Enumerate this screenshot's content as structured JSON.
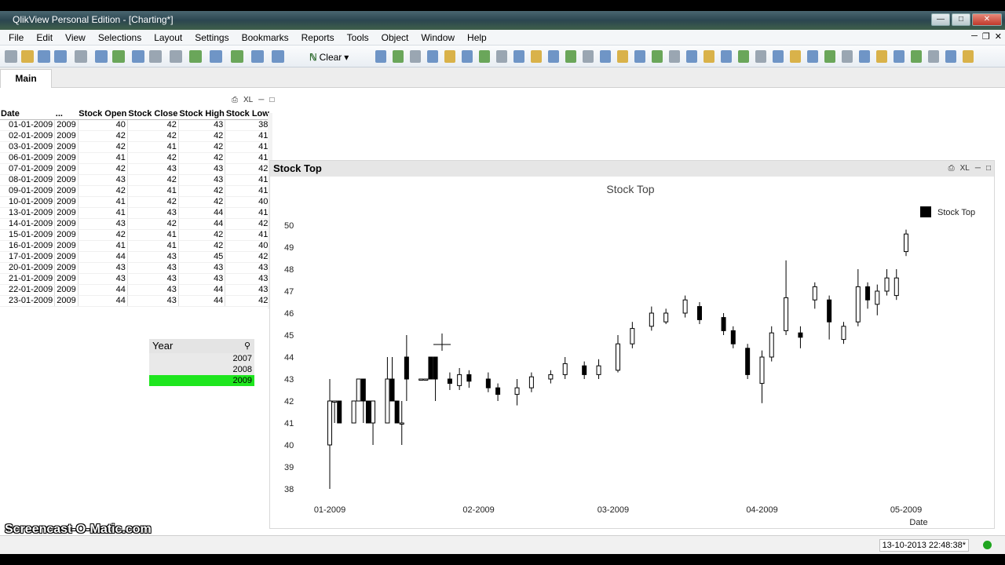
{
  "window": {
    "title": "QlikView Personal Edition - [Charting*]"
  },
  "menu": [
    "File",
    "Edit",
    "View",
    "Selections",
    "Layout",
    "Settings",
    "Bookmarks",
    "Reports",
    "Tools",
    "Object",
    "Window",
    "Help"
  ],
  "toolbar": {
    "clear_label": "Clear"
  },
  "tabs": [
    {
      "label": "Main",
      "active": true
    }
  ],
  "table": {
    "headers": [
      "Date",
      "...",
      "Stock Open",
      "Stock Close",
      "Stock High",
      "Stock Low"
    ],
    "rows": [
      [
        "01-01-2009",
        "2009",
        "40",
        "42",
        "43",
        "38"
      ],
      [
        "02-01-2009",
        "2009",
        "42",
        "42",
        "42",
        "41"
      ],
      [
        "03-01-2009",
        "2009",
        "42",
        "41",
        "42",
        "41"
      ],
      [
        "06-01-2009",
        "2009",
        "41",
        "42",
        "42",
        "41"
      ],
      [
        "07-01-2009",
        "2009",
        "42",
        "43",
        "43",
        "42"
      ],
      [
        "08-01-2009",
        "2009",
        "43",
        "42",
        "43",
        "41"
      ],
      [
        "09-01-2009",
        "2009",
        "42",
        "41",
        "42",
        "41"
      ],
      [
        "10-01-2009",
        "2009",
        "41",
        "42",
        "42",
        "40"
      ],
      [
        "13-01-2009",
        "2009",
        "41",
        "43",
        "44",
        "41"
      ],
      [
        "14-01-2009",
        "2009",
        "43",
        "42",
        "44",
        "42"
      ],
      [
        "15-01-2009",
        "2009",
        "42",
        "41",
        "42",
        "41"
      ],
      [
        "16-01-2009",
        "2009",
        "41",
        "41",
        "42",
        "40"
      ],
      [
        "17-01-2009",
        "2009",
        "44",
        "43",
        "45",
        "42"
      ],
      [
        "20-01-2009",
        "2009",
        "43",
        "43",
        "43",
        "43"
      ],
      [
        "21-01-2009",
        "2009",
        "43",
        "43",
        "43",
        "43"
      ],
      [
        "22-01-2009",
        "2009",
        "44",
        "43",
        "44",
        "43"
      ],
      [
        "23-01-2009",
        "2009",
        "44",
        "43",
        "44",
        "42"
      ]
    ]
  },
  "listbox": {
    "title": "Year",
    "items": [
      {
        "label": "2007",
        "selected": false
      },
      {
        "label": "2008",
        "selected": false
      },
      {
        "label": "2009",
        "selected": true
      }
    ],
    "selected_color": "#1ee61e"
  },
  "chart_caption": "Stock Top",
  "chart_data": {
    "type": "candlestick",
    "title": "Stock Top",
    "xlabel": "Date",
    "ylabel": "",
    "ylim": [
      38,
      50
    ],
    "yticks": [
      38,
      39,
      40,
      41,
      42,
      43,
      44,
      45,
      46,
      47,
      48,
      49,
      50
    ],
    "xticks": [
      "01-2009",
      "02-2009",
      "03-2009",
      "04-2009",
      "05-2009"
    ],
    "xtick_dates": [
      "2009-01-01",
      "2009-02-01",
      "2009-03-01",
      "2009-04-01",
      "2009-05-01"
    ],
    "legend": {
      "entries": [
        "Stock Top"
      ],
      "placement": "top-right"
    },
    "series": [
      {
        "name": "Stock Top",
        "points": [
          {
            "date": "2009-01-01",
            "open": 40,
            "close": 42,
            "high": 43,
            "low": 38
          },
          {
            "date": "2009-01-02",
            "open": 42,
            "close": 42,
            "high": 42,
            "low": 41
          },
          {
            "date": "2009-01-03",
            "open": 42,
            "close": 41,
            "high": 42,
            "low": 41
          },
          {
            "date": "2009-01-06",
            "open": 41,
            "close": 42,
            "high": 42,
            "low": 41
          },
          {
            "date": "2009-01-07",
            "open": 42,
            "close": 43,
            "high": 43,
            "low": 42
          },
          {
            "date": "2009-01-08",
            "open": 43,
            "close": 42,
            "high": 43,
            "low": 41
          },
          {
            "date": "2009-01-09",
            "open": 42,
            "close": 41,
            "high": 42,
            "low": 41
          },
          {
            "date": "2009-01-10",
            "open": 41,
            "close": 42,
            "high": 42,
            "low": 40
          },
          {
            "date": "2009-01-13",
            "open": 41,
            "close": 43,
            "high": 44,
            "low": 41
          },
          {
            "date": "2009-01-14",
            "open": 43,
            "close": 42,
            "high": 44,
            "low": 42
          },
          {
            "date": "2009-01-15",
            "open": 42,
            "close": 41,
            "high": 42,
            "low": 41
          },
          {
            "date": "2009-01-16",
            "open": 41,
            "close": 41,
            "high": 42,
            "low": 40
          },
          {
            "date": "2009-01-17",
            "open": 44,
            "close": 43,
            "high": 45,
            "low": 42
          },
          {
            "date": "2009-01-20",
            "open": 43,
            "close": 43,
            "high": 43,
            "low": 43
          },
          {
            "date": "2009-01-21",
            "open": 43,
            "close": 43,
            "high": 43,
            "low": 43
          },
          {
            "date": "2009-01-22",
            "open": 44,
            "close": 43,
            "high": 44,
            "low": 43
          },
          {
            "date": "2009-01-23",
            "open": 44,
            "close": 43,
            "high": 44,
            "low": 42
          },
          {
            "date": "2009-01-26",
            "open": 43,
            "close": 42.8,
            "high": 43.3,
            "low": 42.5
          },
          {
            "date": "2009-01-28",
            "open": 42.7,
            "close": 43.2,
            "high": 43.5,
            "low": 42.5
          },
          {
            "date": "2009-01-30",
            "open": 43.2,
            "close": 42.9,
            "high": 43.4,
            "low": 42.6
          },
          {
            "date": "2009-02-03",
            "open": 43,
            "close": 42.6,
            "high": 43.3,
            "low": 42.4
          },
          {
            "date": "2009-02-05",
            "open": 42.6,
            "close": 42.3,
            "high": 42.8,
            "low": 42
          },
          {
            "date": "2009-02-09",
            "open": 42.3,
            "close": 42.6,
            "high": 43,
            "low": 41.8
          },
          {
            "date": "2009-02-12",
            "open": 42.6,
            "close": 43.1,
            "high": 43.3,
            "low": 42.4
          },
          {
            "date": "2009-02-16",
            "open": 43,
            "close": 43.2,
            "high": 43.4,
            "low": 42.8
          },
          {
            "date": "2009-02-19",
            "open": 43.2,
            "close": 43.7,
            "high": 44,
            "low": 43
          },
          {
            "date": "2009-02-23",
            "open": 43.6,
            "close": 43.2,
            "high": 43.8,
            "low": 43
          },
          {
            "date": "2009-02-26",
            "open": 43.2,
            "close": 43.6,
            "high": 43.9,
            "low": 43
          },
          {
            "date": "2009-03-02",
            "open": 43.4,
            "close": 44.6,
            "high": 45,
            "low": 43.3
          },
          {
            "date": "2009-03-05",
            "open": 44.6,
            "close": 45.3,
            "high": 45.6,
            "low": 44.4
          },
          {
            "date": "2009-03-09",
            "open": 45.4,
            "close": 46,
            "high": 46.3,
            "low": 45.2
          },
          {
            "date": "2009-03-12",
            "open": 45.6,
            "close": 46,
            "high": 46.2,
            "low": 45.5
          },
          {
            "date": "2009-03-16",
            "open": 46,
            "close": 46.6,
            "high": 46.8,
            "low": 45.8
          },
          {
            "date": "2009-03-19",
            "open": 46.3,
            "close": 45.7,
            "high": 46.5,
            "low": 45.5
          },
          {
            "date": "2009-03-24",
            "open": 45.8,
            "close": 45.2,
            "high": 46,
            "low": 45
          },
          {
            "date": "2009-03-26",
            "open": 45.2,
            "close": 44.6,
            "high": 45.4,
            "low": 44.4
          },
          {
            "date": "2009-03-29",
            "open": 44.4,
            "close": 43.2,
            "high": 44.6,
            "low": 43
          },
          {
            "date": "2009-04-01",
            "open": 42.8,
            "close": 44,
            "high": 44.3,
            "low": 41.9
          },
          {
            "date": "2009-04-03",
            "open": 44,
            "close": 45.1,
            "high": 45.4,
            "low": 43.8
          },
          {
            "date": "2009-04-06",
            "open": 45.2,
            "close": 46.7,
            "high": 48.4,
            "low": 45
          },
          {
            "date": "2009-04-09",
            "open": 45.1,
            "close": 44.9,
            "high": 45.4,
            "low": 44.4
          },
          {
            "date": "2009-04-12",
            "open": 46.6,
            "close": 47.2,
            "high": 47.4,
            "low": 46.2
          },
          {
            "date": "2009-04-15",
            "open": 46.6,
            "close": 45.6,
            "high": 46.8,
            "low": 44.8
          },
          {
            "date": "2009-04-18",
            "open": 44.8,
            "close": 45.4,
            "high": 45.6,
            "low": 44.6
          },
          {
            "date": "2009-04-21",
            "open": 45.6,
            "close": 47.2,
            "high": 48,
            "low": 45.4
          },
          {
            "date": "2009-04-23",
            "open": 47.2,
            "close": 46.6,
            "high": 47.4,
            "low": 46.2
          },
          {
            "date": "2009-04-25",
            "open": 46.4,
            "close": 47,
            "high": 47.3,
            "low": 45.9
          },
          {
            "date": "2009-04-27",
            "open": 47,
            "close": 47.6,
            "high": 48,
            "low": 46.8
          },
          {
            "date": "2009-04-29",
            "open": 46.8,
            "close": 47.6,
            "high": 48,
            "low": 46.6
          },
          {
            "date": "2009-05-01",
            "open": 48.8,
            "close": 49.6,
            "high": 49.8,
            "low": 48.6
          }
        ]
      }
    ]
  },
  "status": {
    "timestamp": "13-10-2013 22:48:38*"
  },
  "watermark": "Screencast-O-Matic.com"
}
